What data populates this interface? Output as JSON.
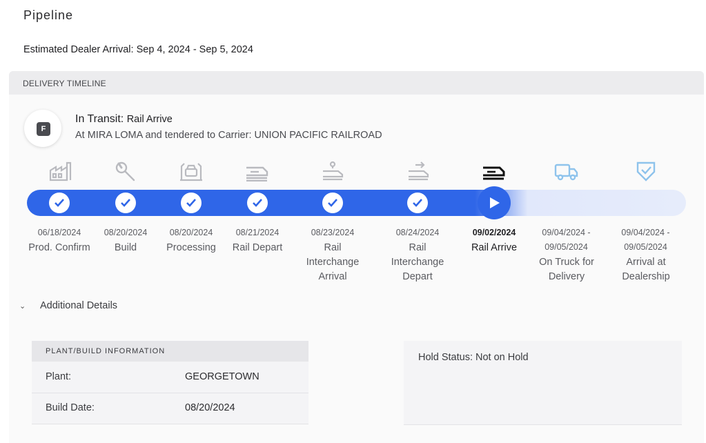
{
  "page": {
    "title": "Pipeline",
    "estimated_arrival": "Estimated Dealer Arrival: Sep 4, 2024 - Sep 5, 2024"
  },
  "timeline": {
    "header": "DELIVERY TIMELINE",
    "status_icon_letter": "F",
    "status_prefix": "In Transit:",
    "status_stage": "Rail Arrive",
    "status_detail": "At MIRA LOMA and tendered to Carrier: UNION PACIFIC RAILROAD",
    "stages": [
      {
        "date": "06/18/2024",
        "label": "Prod. Confirm",
        "state": "done",
        "icon": "factory-icon"
      },
      {
        "date": "08/20/2024",
        "label": "Build",
        "state": "done",
        "icon": "wrench-icon"
      },
      {
        "date": "08/20/2024",
        "label": "Processing",
        "state": "done",
        "icon": "car-processing-icon"
      },
      {
        "date": "08/21/2024",
        "label": "Rail Depart",
        "state": "done",
        "icon": "rail-car-icon"
      },
      {
        "date": "08/23/2024",
        "label": "Rail Interchange Arrival",
        "state": "done",
        "icon": "rail-location-icon"
      },
      {
        "date": "08/24/2024",
        "label": "Rail Interchange Depart",
        "state": "done",
        "icon": "rail-depart-icon"
      },
      {
        "date": "09/02/2024",
        "label": "Rail Arrive",
        "state": "current",
        "icon": "rail-car-icon"
      },
      {
        "date": "09/04/2024 - 09/05/2024",
        "label": "On Truck for Delivery",
        "state": "pending",
        "icon": "truck-icon"
      },
      {
        "date": "09/04/2024 - 09/05/2024",
        "label": "Arrival at Dealership",
        "state": "pending",
        "icon": "shield-check-icon"
      }
    ],
    "colors": {
      "accent": "#2f66e8",
      "track_pending": "#e6ecfb",
      "icon_done": "#b9babf",
      "icon_pending": "#8ec3ec"
    }
  },
  "details": {
    "toggle_label": "Additional Details",
    "plant_card": {
      "header": "PLANT/BUILD INFORMATION",
      "rows": [
        {
          "key": "Plant:",
          "value": "GEORGETOWN"
        },
        {
          "key": "Build Date:",
          "value": "08/20/2024"
        }
      ]
    },
    "hold_status": "Hold Status: Not on Hold"
  }
}
